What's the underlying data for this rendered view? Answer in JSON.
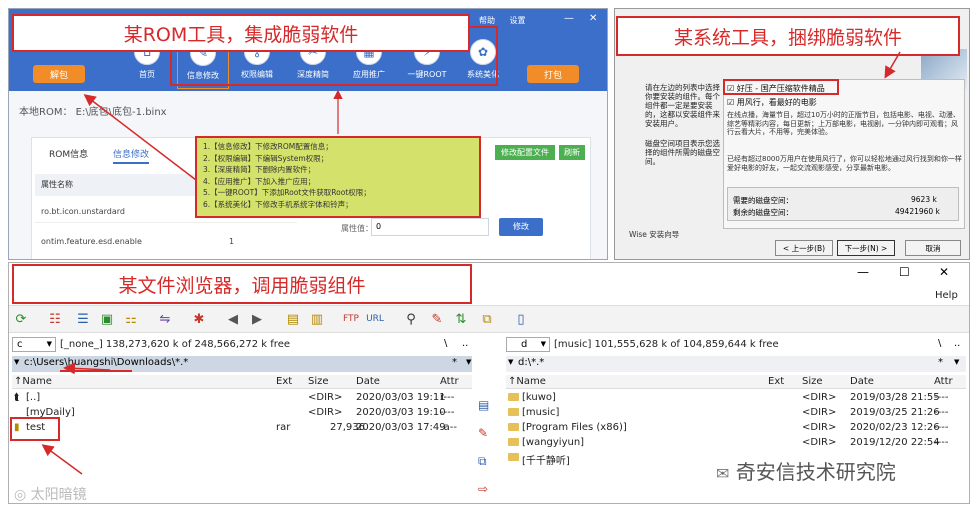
{
  "captions": {
    "rom": "某ROM工具，集成脆弱软件",
    "system": "某系统工具，捆绑脆弱软件",
    "browser": "某文件浏览器，调用脆弱组件"
  },
  "rom_tool": {
    "top_menu": [
      "帮助",
      "设置"
    ],
    "win_controls": [
      "—",
      "✕"
    ],
    "unpack_button": "解包",
    "pack_button": "打包",
    "toolbar": [
      {
        "label": "首页",
        "icon": "home-icon"
      },
      {
        "label": "信息修改",
        "icon": "edit-icon"
      },
      {
        "label": "权限编辑",
        "icon": "key-icon"
      },
      {
        "label": "深度精简",
        "icon": "trim-icon"
      },
      {
        "label": "应用推广",
        "icon": "apps-icon"
      },
      {
        "label": "一键ROOT",
        "icon": "root-icon"
      },
      {
        "label": "系统美化",
        "icon": "palette-icon"
      }
    ],
    "local_rom_label": "本地ROM： E:\\底包\\底包-1.binx",
    "tabs": [
      "ROM信息",
      "信息修改"
    ],
    "edit_config_button": "修改配置文件",
    "refresh_button": "刷新",
    "table_header": "属性名称",
    "rows": [
      {
        "name": "ro.bt.icon.unstardard",
        "value": ""
      },
      {
        "name": "ontim.feature.esd.enable",
        "value": "1"
      }
    ],
    "attr_value_label": "属性值：",
    "attr_value_input": "0",
    "modify_button": "修改",
    "info_list": [
      "1.【信息修改】下修改ROM配置信息；",
      "2.【权限编辑】下编辑System权限；",
      "3.【深度精简】下删除内置软件；",
      "4.【应用推广】下加入推广应用；",
      "5.【一键ROOT】下添加Root文件获取Root权限；",
      "6.【系统美化】下修改手机系统字体和铃声；"
    ]
  },
  "system_tool": {
    "intro_text": "请在左边的列表中选择你要安装的组件。每个组件都一定是要安装的，这都以安装组件来安装用户。",
    "checkbox_1": "好压 - 国产压缩软件精品",
    "checkbox_2": "用风行，看最好的电影",
    "desc_text": "在线点播，海量节目，超过10万小时的正版节目，包括电影、电视、动漫、综艺等精彩内容，每日更新；上万部电影，电视剧，一分钟内即可观看；风行云看大片，不用等，完美体验。",
    "disk_space_text": "磁盘空间项目表示您选择的组件所需的磁盘空间。",
    "users_text": "已经有超过8000万用户在使用风行了，你可以轻松地通过风行找到和你一样爱好电影的好友，一起交流观影感受，分享最新电影。",
    "required_label": "需要的磁盘空间：",
    "required_value": "9623 k",
    "remaining_label": "剩余的磁盘空间：",
    "remaining_value": "49421960 k",
    "wise_label": "Wise 安装向导",
    "back_button": "< 上一步(B)",
    "next_button": "下一步(N) >",
    "cancel_button": "取消"
  },
  "file_browser": {
    "win_controls": [
      "—",
      "☐",
      "✕"
    ],
    "help_label": "Help",
    "left": {
      "drive": "c",
      "drive_info": "[_none_]  138,273,620 k of 248,566,272 k free",
      "path": "c:\\Users\\huangshi\\Downloads\\*.*",
      "columns": [
        "↑Name",
        "Ext",
        "Size",
        "Date",
        "Attr"
      ],
      "rows": [
        {
          "name": "[..]",
          "ext": "",
          "size": "<DIR>",
          "date": "2020/03/03 19:11",
          "attr": "r---"
        },
        {
          "name": "[myDaily]",
          "ext": "",
          "size": "<DIR>",
          "date": "2020/03/03 19:10",
          "attr": "----"
        },
        {
          "name": "test",
          "ext": "rar",
          "size": "27,936",
          "date": "2020/03/03 17:49",
          "attr": "-a--"
        }
      ]
    },
    "right": {
      "drive": "d",
      "drive_info": "[music]  101,555,628 k of 104,859,644 k free",
      "path": "d:\\*.*",
      "columns": [
        "↑Name",
        "Ext",
        "Size",
        "Date",
        "Attr"
      ],
      "rows": [
        {
          "name": "[kuwo]",
          "ext": "",
          "size": "<DIR>",
          "date": "2019/03/28 21:55",
          "attr": "----"
        },
        {
          "name": "[music]",
          "ext": "",
          "size": "<DIR>",
          "date": "2019/03/25 21:26",
          "attr": "----"
        },
        {
          "name": "[Program Files (x86)]",
          "ext": "",
          "size": "<DIR>",
          "date": "2020/02/23 12:26",
          "attr": "----"
        },
        {
          "name": "[wangyiyun]",
          "ext": "",
          "size": "<DIR>",
          "date": "2019/12/20 22:54",
          "attr": "----"
        },
        {
          "name": "[千千静听]",
          "ext": "",
          "size": "<DIR>",
          "date": "",
          "attr": ""
        }
      ]
    }
  },
  "watermarks": {
    "left": "太阳暗镜",
    "right": "奇安信技术研究院"
  },
  "colors": {
    "caption_red": "#d62a2a",
    "rom_blue": "#3b6fc9",
    "accent_orange": "#f28c28",
    "info_green_bg": "#d4e26b",
    "tab_green": "#4caf50"
  }
}
